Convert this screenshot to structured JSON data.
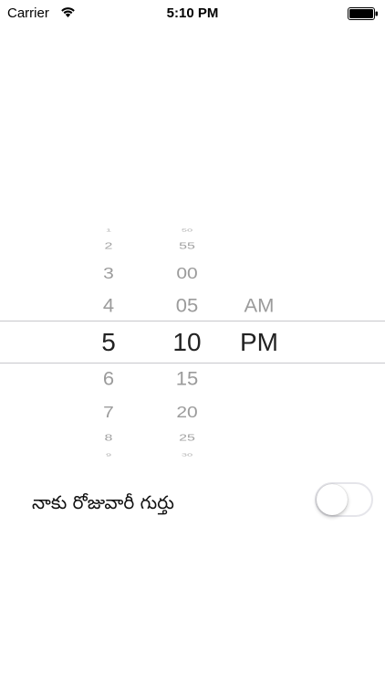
{
  "status_bar": {
    "carrier": "Carrier",
    "time": "5:10 PM",
    "wifi_icon": "wifi-icon",
    "battery_icon": "battery-icon",
    "battery_level": 1.0
  },
  "picker": {
    "hours": [
      "1",
      "2",
      "3",
      "4",
      "5",
      "6",
      "7",
      "8",
      "9"
    ],
    "minutes": [
      "50",
      "55",
      "00",
      "05",
      "10",
      "15",
      "20",
      "25",
      "30"
    ],
    "periods": [
      "AM",
      "PM"
    ],
    "selected": {
      "hour": "5",
      "minute": "10",
      "period": "PM"
    }
  },
  "reminder": {
    "label": "నాకు రోజువారీ గుర్తు",
    "enabled": false
  },
  "colors": {
    "selected_text": "#222222",
    "unselected_text": "#9b9b9b",
    "divider": "#c8c8cc",
    "toggle_border": "#e5e5ea"
  }
}
